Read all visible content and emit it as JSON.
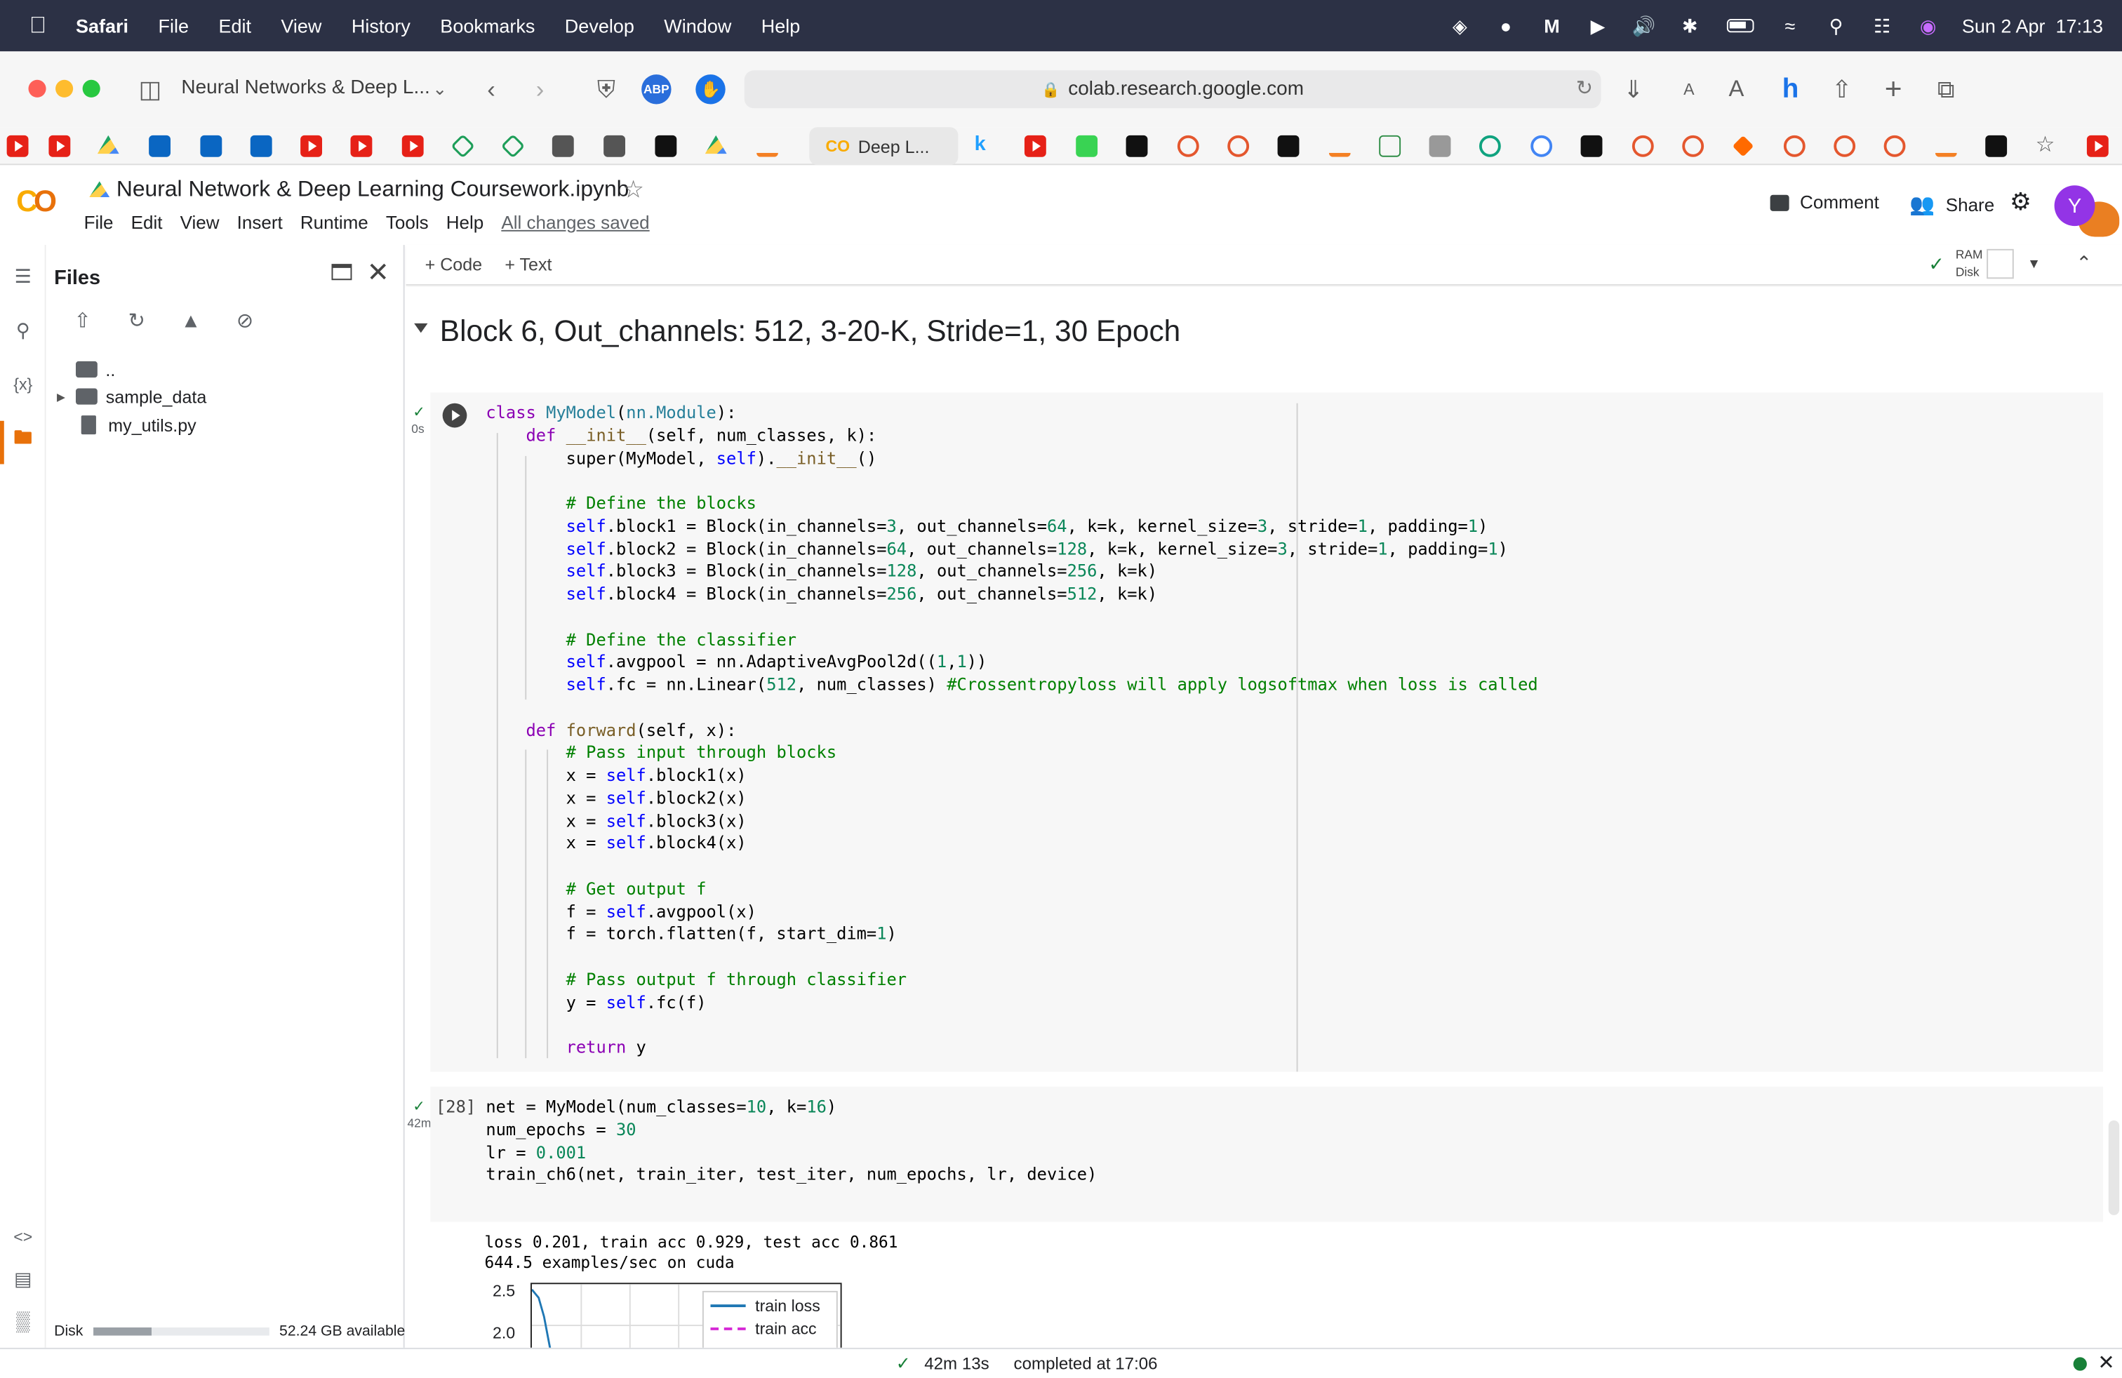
{
  "menubar": {
    "app": "Safari",
    "items": [
      "File",
      "Edit",
      "View",
      "History",
      "Bookmarks",
      "Develop",
      "Window",
      "Help"
    ],
    "clock": "Sun 2 Apr  17:13"
  },
  "safari": {
    "tab_group_title": "Neural Networks & Deep L...",
    "url": "colab.research.google.com",
    "abp_label": "ABP",
    "font_small": "A",
    "font_large": "A",
    "pinned_tab": "Deep L..."
  },
  "colab": {
    "logo": "CO",
    "notebook_title": "Neural Network & Deep Learning Coursework.ipynb",
    "menu": [
      "File",
      "Edit",
      "View",
      "Insert",
      "Runtime",
      "Tools",
      "Help"
    ],
    "saved_status": "All changes saved",
    "comment_label": "Comment",
    "share_label": "Share",
    "avatar_letter": "Y",
    "add_code": "+ Code",
    "add_text": "+ Text",
    "ram_label": "RAM",
    "disk_label": "Disk"
  },
  "files_panel": {
    "title": "Files",
    "tree": [
      {
        "name": "..",
        "type": "parent"
      },
      {
        "name": "sample_data",
        "type": "folder"
      },
      {
        "name": "my_utils.py",
        "type": "file"
      }
    ],
    "disk_label": "Disk",
    "disk_available": "52.24 GB available",
    "disk_used_fraction": 0.33
  },
  "notebook": {
    "section_heading": "Block 6, Out_channels: 512, 3-20-K, Stride=1, 30 Epoch",
    "cell1": {
      "exec_time": "0s"
    },
    "cell2": {
      "exec_count": "[28]",
      "exec_time": "42m"
    },
    "output_lines": [
      "loss 0.201, train acc 0.929, test acc 0.861",
      "644.5 examples/sec on cuda"
    ],
    "plot": {
      "yticks": [
        "2.5",
        "2.0"
      ],
      "legend": [
        "train loss",
        "train acc"
      ]
    }
  },
  "statusbar": {
    "duration": "42m 13s",
    "completed": "completed at 17:06"
  },
  "colors": {
    "menubar_bg": "#2c3145",
    "colab_orange": "#f9ab00",
    "avatar": "#9334e6",
    "ok_green": "#188038"
  }
}
